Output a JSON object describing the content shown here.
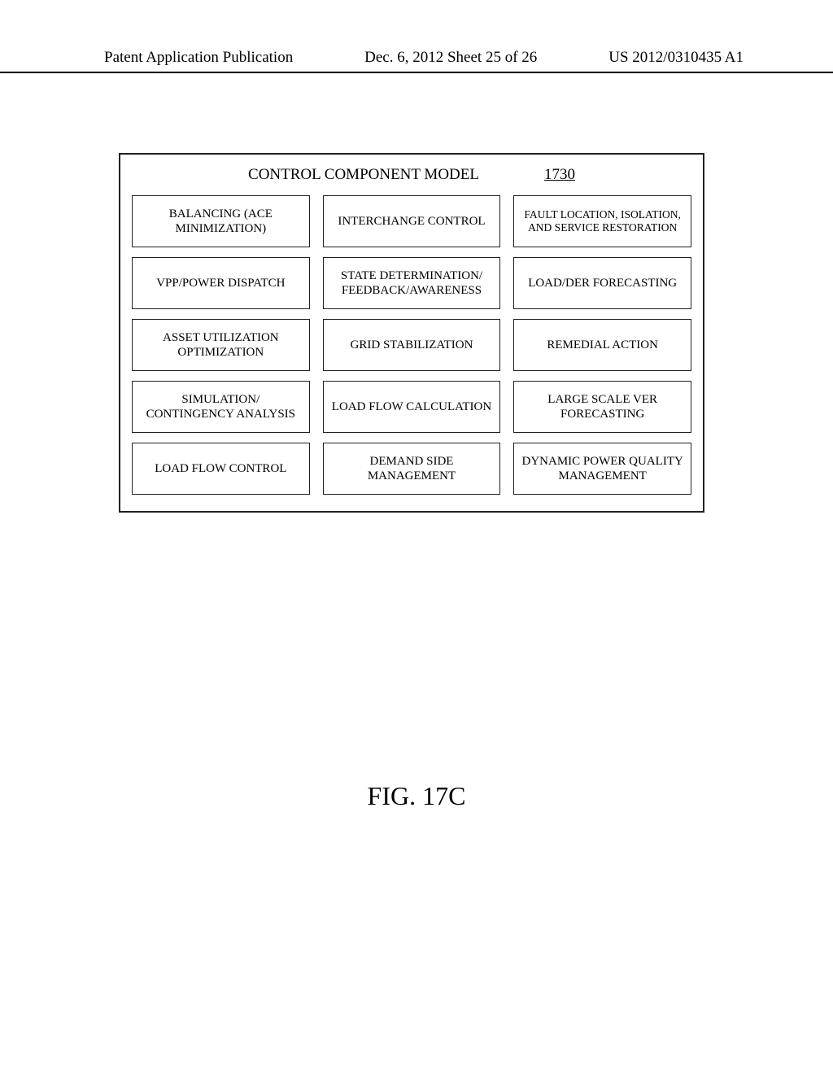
{
  "header": {
    "left": "Patent Application Publication",
    "middle": "Dec. 6, 2012   Sheet 25 of 26",
    "right": "US 2012/0310435 A1"
  },
  "diagram": {
    "title": "CONTROL COMPONENT MODEL",
    "ref": "1730",
    "cells": [
      "BALANCING (ACE MINIMIZATION)",
      "INTERCHANGE CONTROL",
      "FAULT LOCATION, ISOLATION, AND SERVICE RESTORATION",
      "VPP/POWER DISPATCH",
      "STATE DETERMINATION/ FEEDBACK/AWARENESS",
      "LOAD/DER FORECASTING",
      "ASSET UTILIZATION OPTIMIZATION",
      "GRID STABILIZATION",
      "REMEDIAL ACTION",
      "SIMULATION/ CONTINGENCY ANALYSIS",
      "LOAD FLOW CALCULATION",
      "LARGE SCALE VER FORECASTING",
      "LOAD FLOW CONTROL",
      "DEMAND SIDE MANAGEMENT",
      "DYNAMIC POWER QUALITY MANAGEMENT"
    ]
  },
  "figure_caption": "FIG. 17C"
}
